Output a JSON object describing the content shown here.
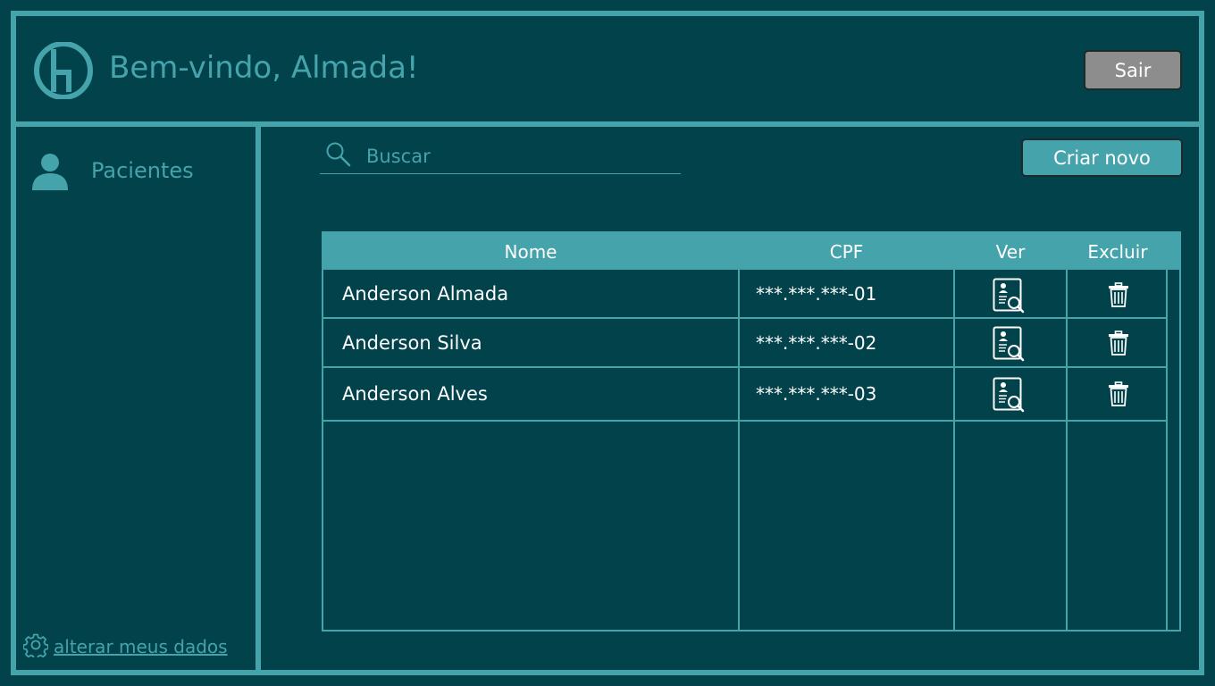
{
  "header": {
    "welcome": "Bem-vindo, Almada!",
    "logout_label": "Sair"
  },
  "sidebar": {
    "items": [
      {
        "label": "Pacientes",
        "icon": "user-icon"
      }
    ],
    "settings_label": "alterar meus dados"
  },
  "search": {
    "placeholder": "Buscar"
  },
  "create_label": "Criar novo",
  "table": {
    "columns": [
      "Nome",
      "CPF",
      "Ver",
      "Excluir"
    ],
    "rows": [
      {
        "name": "Anderson Almada",
        "cpf": "***.***.***-01"
      },
      {
        "name": "Anderson Silva",
        "cpf": "***.***.***-02"
      },
      {
        "name": "Anderson Alves",
        "cpf": "***.***.***-03"
      }
    ]
  },
  "colors": {
    "background": "#02424b",
    "accent": "#45a3ab",
    "logout_button": "#8d8d8d"
  }
}
